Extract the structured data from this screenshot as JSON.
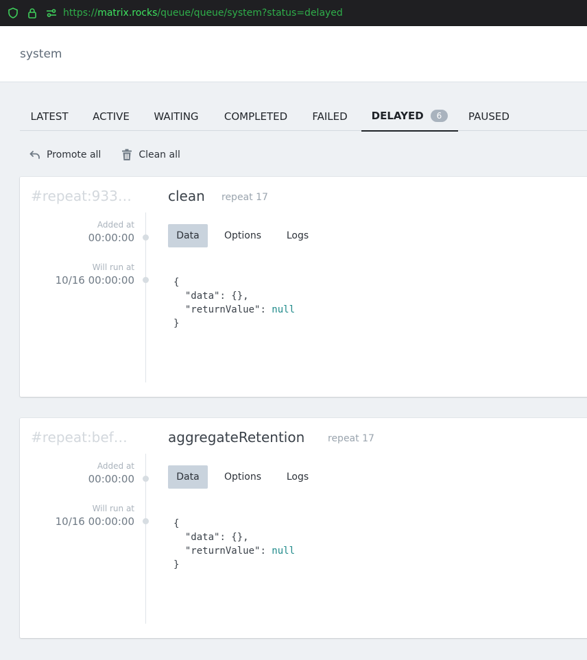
{
  "browser": {
    "url_scheme": "https://",
    "url_host": "matrix.rocks",
    "url_path": "/queue/queue/system?status=delayed"
  },
  "header": {
    "title": "system"
  },
  "tabs": [
    {
      "label": "LATEST"
    },
    {
      "label": "ACTIVE"
    },
    {
      "label": "WAITING"
    },
    {
      "label": "COMPLETED"
    },
    {
      "label": "FAILED"
    },
    {
      "label": "DELAYED",
      "badge": "6",
      "active": true
    },
    {
      "label": "PAUSED"
    }
  ],
  "actions": {
    "promote_all": "Promote all",
    "clean_all": "Clean all"
  },
  "jobs": [
    {
      "id": "#repeat:933…",
      "name": "clean",
      "repeat": "repeat 17",
      "added_label": "Added at",
      "added_value": "00:00:00",
      "run_label": "Will run at",
      "run_value": "10/16 00:00:00",
      "subtabs": {
        "data": "Data",
        "options": "Options",
        "logs": "Logs"
      },
      "code": {
        "open": "{",
        "data_key": "\"data\"",
        "data_val": ": {},",
        "rv_key": "\"returnValue\"",
        "rv_sep": ": ",
        "rv_val": "null",
        "close": "}"
      }
    },
    {
      "id": "#repeat:bef…",
      "name": "aggregateRetention",
      "repeat": "repeat 17",
      "added_label": "Added at",
      "added_value": "00:00:00",
      "run_label": "Will run at",
      "run_value": "10/16 00:00:00",
      "subtabs": {
        "data": "Data",
        "options": "Options",
        "logs": "Logs"
      },
      "code": {
        "open": "{",
        "data_key": "\"data\"",
        "data_val": ": {},",
        "rv_key": "\"returnValue\"",
        "rv_sep": ": ",
        "rv_val": "null",
        "close": "}"
      }
    }
  ]
}
